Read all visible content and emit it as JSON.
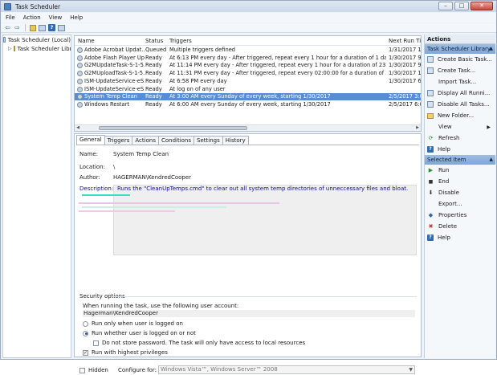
{
  "window": {
    "title": "Task Scheduler"
  },
  "menu": [
    "File",
    "Action",
    "View",
    "Help"
  ],
  "tree": {
    "root": "Task Scheduler (Local)",
    "library": "Task Scheduler Libra"
  },
  "tasklist": {
    "columns": {
      "name": "Name",
      "status": "Status",
      "triggers": "Triggers",
      "next_run": "Next Run Tim"
    },
    "rows": [
      {
        "name": "Adobe Acrobat Updat...",
        "status": "Queued",
        "triggers": "Multiple triggers defined",
        "next": "1/31/2017 1"
      },
      {
        "name": "Adobe Flash Player Up...",
        "status": "Ready",
        "triggers": "At 6:13 PM every day - After triggered, repeat every 1 hour for a duration of 1 day.",
        "next": "1/30/2017 9"
      },
      {
        "name": "G2MUpdateTask-S-1-5...",
        "status": "Ready",
        "triggers": "At 11:14 PM every day - After triggered, repeat every 1 hour for a duration of 23:59:00.",
        "next": "1/30/2017 9"
      },
      {
        "name": "G2MUploadTask-S-1-5...",
        "status": "Ready",
        "triggers": "At 11:31 PM every day - After triggered, repeat every 02:00:00 for a duration of 23:59:00.",
        "next": "1/30/2017 1"
      },
      {
        "name": "ISM-UpdateService-eS...",
        "status": "Ready",
        "triggers": "At 6:58 PM every day",
        "next": "1/30/2017 6"
      },
      {
        "name": "ISM-UpdateService-eS...",
        "status": "Ready",
        "triggers": "At log on of any user",
        "next": ""
      },
      {
        "name": "System Temp Clean",
        "status": "Ready",
        "triggers": "At 3:00 AM every Sunday of every week, starting 1/30/2017",
        "next": "2/5/2017 3:0"
      },
      {
        "name": "Windows Restart",
        "status": "Ready",
        "triggers": "At 6:00 AM every Sunday of every week, starting 1/30/2017",
        "next": "2/5/2017 6:0"
      }
    ],
    "selected_index": 6
  },
  "tabs": [
    "General",
    "Triggers",
    "Actions",
    "Conditions",
    "Settings",
    "History"
  ],
  "general": {
    "name_label": "Name:",
    "name_value": "System Temp Clean",
    "location_label": "Location:",
    "location_value": "\\",
    "author_label": "Author:",
    "author_value": "HAGERMAN\\KendredCooper",
    "description_label": "Description:",
    "description_value": "Runs the \"CleanUpTemps.cmd\" to clear out all system temp directories of unneccessary files and bloat.",
    "security": {
      "legend": "Security options",
      "account_label": "When running the task, use the following user account:",
      "account_value": "Hagerman\\KendredCooper",
      "opt_logged_on": "Run only when user is logged on",
      "opt_whether": "Run whether user is logged on or not",
      "opt_no_password": "Do not store password.  The task will only have access to local resources",
      "opt_highest": "Run with highest privileges"
    },
    "hidden_label": "Hidden",
    "configure_label": "Configure for:",
    "configure_value": "Windows Vista™, Windows Server™ 2008"
  },
  "actions_pane": {
    "header": "Actions",
    "library_section": "Task Scheduler Library",
    "library_actions": [
      {
        "label": "Create Basic Task...",
        "icon": "create-basic-task-icon"
      },
      {
        "label": "Create Task...",
        "icon": "create-task-icon"
      },
      {
        "label": "Import Task...",
        "icon": ""
      },
      {
        "label": "Display All Runni...",
        "icon": "display-running-icon"
      },
      {
        "label": "Disable All Tasks...",
        "icon": "disable-all-icon"
      },
      {
        "label": "New Folder...",
        "icon": "folder-icon"
      },
      {
        "label": "View",
        "icon": ""
      },
      {
        "label": "Refresh",
        "icon": "refresh-icon"
      },
      {
        "label": "Help",
        "icon": "help-icon"
      }
    ],
    "item_section": "Selected Item",
    "item_actions": [
      {
        "label": "Run",
        "icon": "run-icon"
      },
      {
        "label": "End",
        "icon": "end-icon"
      },
      {
        "label": "Disable",
        "icon": "disable-icon"
      },
      {
        "label": "Export...",
        "icon": ""
      },
      {
        "label": "Properties",
        "icon": "properties-icon"
      },
      {
        "label": "Delete",
        "icon": "delete-icon"
      },
      {
        "label": "Help",
        "icon": "help-icon"
      }
    ]
  },
  "colors": {
    "selection": "#5a8bd4",
    "section_header": "#8eb1dc",
    "description_text": "#0f0f8a"
  }
}
